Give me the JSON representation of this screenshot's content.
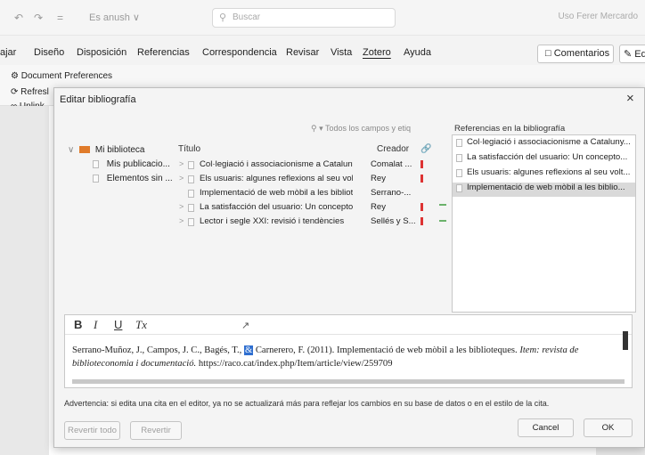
{
  "titlebar": {
    "undo": "↶",
    "redo": "↷",
    "doc_name": "Es anush ∨",
    "search_placeholder": "Buscar",
    "user": "Uso Ferer Mercardo"
  },
  "menu": {
    "items": [
      "ajar",
      "Diseño",
      "Disposición",
      "Referencias",
      "Correspondencia",
      "Revisar",
      "Vista",
      "Zotero",
      "Ayuda"
    ],
    "active": "Zotero",
    "comments_label": "Comentarios",
    "edit_label": "Ed"
  },
  "ribbon": {
    "doc_prefs": "Document Preferences",
    "refresh": "Refresl",
    "unlink": "Unlink"
  },
  "dialog": {
    "title": "Editar bibliografía",
    "close": "×",
    "filter_placeholder": "Todos los campos y etiq",
    "tree": [
      {
        "label": "Mi biblioteca"
      },
      {
        "label": "Mis publicacio..."
      },
      {
        "label": "Elementos sin ..."
      }
    ],
    "columns": {
      "title": "Título",
      "creator": "Creador"
    },
    "items": [
      {
        "title": "Col·legiació i associacionisme a Cataluny...",
        "creator": "Comalat ...",
        "flag": true
      },
      {
        "title": "Els usuaris: algunes reflexions al seu volta...",
        "creator": "Rey",
        "flag": true
      },
      {
        "title": "Implementació de web mòbil a les bibliot...",
        "creator": "Serrano-...",
        "flag": false
      },
      {
        "title": "La satisfacción del usuario: Un concepto ...",
        "creator": "Rey",
        "flag": true
      },
      {
        "title": "Lector i segle XXI: revisió i tendències",
        "creator": "Sellés y S...",
        "flag": true
      }
    ],
    "refs_label": "Referencias en la bibliografía",
    "refs": [
      {
        "label": "Col·legiació i associacionisme a Cataluny...",
        "selected": false
      },
      {
        "label": "La satisfacción del usuario: Un concepto...",
        "selected": false
      },
      {
        "label": "Els usuaris: algunes reflexions al seu volt...",
        "selected": false
      },
      {
        "label": "Implementació de web mòbil a les biblio...",
        "selected": true
      }
    ],
    "editor": {
      "bold": "B",
      "italic": "I",
      "underline": "U",
      "clear": "Tx",
      "citation_a": "Serrano-Muñoz, J., Campos, J. C., Bagés, T., ",
      "citation_hl": "&",
      "citation_b": " Carnerero, F. (2011). Implementació de web mòbil a les biblioteques. ",
      "citation_italic": "Item: revista de biblioteconomia i documentació.",
      "citation_url": " https://raco.cat/index.php/Item/article/view/259709"
    },
    "warning": "Advertencia: si edita una cita en el editor, ya no se actualizará más para reflejar los cambios en su base de datos o en el estilo de la cita.",
    "buttons": {
      "revert_all": "Revertir todo",
      "revert": "Revertir",
      "cancel": "Cancel",
      "ok": "OK"
    }
  }
}
